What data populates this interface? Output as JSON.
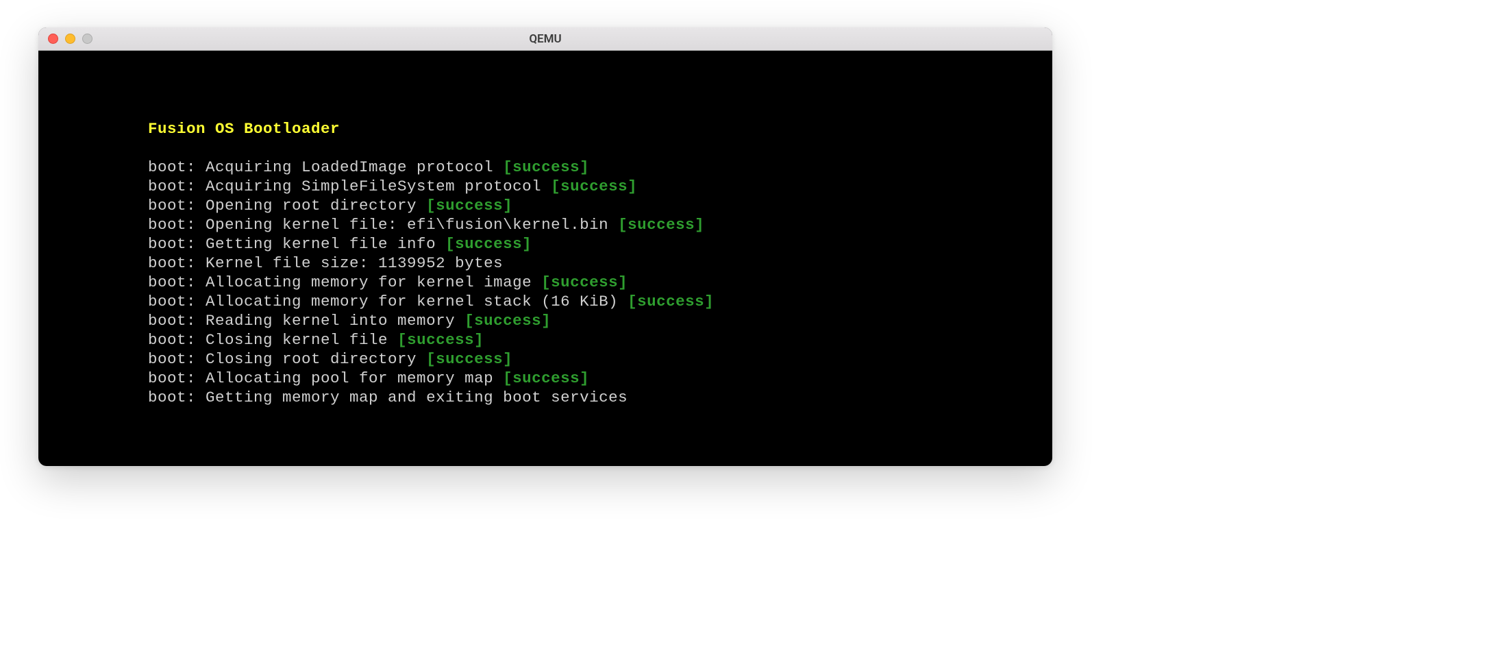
{
  "window": {
    "title": "QEMU"
  },
  "terminal": {
    "heading": "Fusion OS Bootloader",
    "lines": [
      {
        "text": "boot: Acquiring LoadedImage protocol ",
        "status": "[success]"
      },
      {
        "text": "boot: Acquiring SimpleFileSystem protocol ",
        "status": "[success]"
      },
      {
        "text": "boot: Opening root directory ",
        "status": "[success]"
      },
      {
        "text": "boot: Opening kernel file: efi\\fusion\\kernel.bin ",
        "status": "[success]"
      },
      {
        "text": "boot: Getting kernel file info ",
        "status": "[success]"
      },
      {
        "text": "boot: Kernel file size: 1139952 bytes",
        "status": ""
      },
      {
        "text": "boot: Allocating memory for kernel image ",
        "status": "[success]"
      },
      {
        "text": "boot: Allocating memory for kernel stack (16 KiB) ",
        "status": "[success]"
      },
      {
        "text": "boot: Reading kernel into memory ",
        "status": "[success]"
      },
      {
        "text": "boot: Closing kernel file ",
        "status": "[success]"
      },
      {
        "text": "boot: Closing root directory ",
        "status": "[success]"
      },
      {
        "text": "boot: Allocating pool for memory map ",
        "status": "[success]"
      },
      {
        "text": "boot: Getting memory map and exiting boot services",
        "status": ""
      }
    ]
  }
}
